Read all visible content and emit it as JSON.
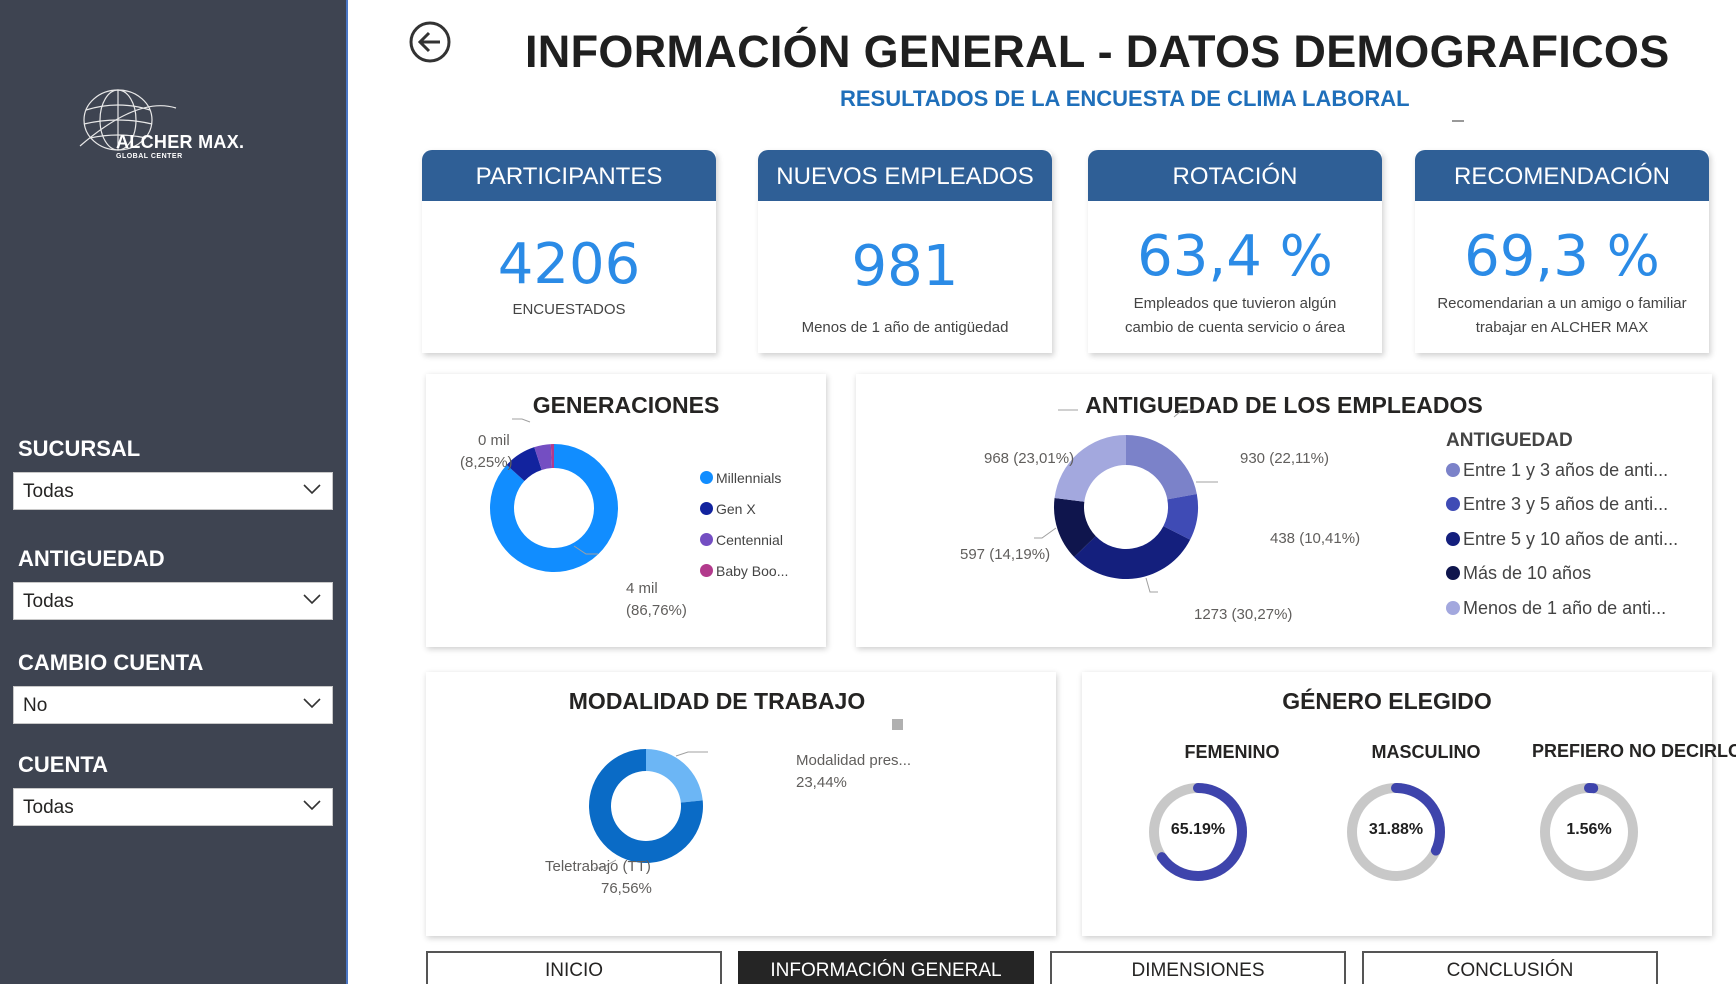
{
  "header": {
    "title": "INFORMACIÓN GENERAL - DATOS DEMOGRAFICOS",
    "subtitle": "RESULTADOS DE LA ENCUESTA DE CLIMA LABORAL"
  },
  "brand": {
    "name": "ALCHER MAX.",
    "tagline": "GLOBAL CENTER"
  },
  "filters": [
    {
      "label": "SUCURSAL",
      "value": "Todas"
    },
    {
      "label": "ANTIGUEDAD",
      "value": "Todas"
    },
    {
      "label": "CAMBIO CUENTA",
      "value": "No"
    },
    {
      "label": "CUENTA",
      "value": "Todas"
    }
  ],
  "kpis": [
    {
      "title": "PARTICIPANTES",
      "value": "4206",
      "caption1": "ENCUESTADOS",
      "caption2": ""
    },
    {
      "title": "NUEVOS EMPLEADOS",
      "value": "981",
      "caption1": "Menos de 1 año de antigüedad",
      "caption2": ""
    },
    {
      "title": "ROTACIÓN",
      "value": "63,4 %",
      "caption1": "Empleados que tuvieron algún",
      "caption2": "cambio de cuenta servicio o área"
    },
    {
      "title": "RECOMENDACIÓN",
      "value": "69,3 %",
      "caption1": "Recomendarian a un amigo o familiar",
      "caption2": "trabajar en ALCHER MAX"
    }
  ],
  "generaciones": {
    "title": "GENERACIONES",
    "label_small_1": "0 mil",
    "label_small_2": "(8,25%)",
    "label_big_1": "4 mil",
    "label_big_2": "(86,76%)",
    "legend": [
      "Millennials",
      "Gen X",
      "Centennial",
      "Baby Boo..."
    ]
  },
  "antiguedad": {
    "title": "ANTIGUEDAD DE LOS EMPLEADOS",
    "legend_title": "ANTIGUEDAD",
    "legend": [
      "Entre 1 y 3 años de anti...",
      "Entre 3 y 5 años de anti...",
      "Entre 5 y 10 años de anti...",
      "Más de 10 años",
      "Menos de 1 año de anti..."
    ],
    "labels": [
      "930 (22,11%)",
      "438 (10,41%)",
      "1273 (30,27%)",
      "597 (14,19%)",
      "968 (23,01%)"
    ]
  },
  "modalidad": {
    "title": "MODALIDAD DE TRABAJO",
    "label_pres_1": "Modalidad pres...",
    "label_pres_2": "23,44%",
    "label_tt_1": "Teletrabajo (TT)",
    "label_tt_2": "76,56%"
  },
  "genero": {
    "title": "GÉNERO ELEGIDO",
    "items": [
      {
        "label": "FEMENINO",
        "value": "65.19%"
      },
      {
        "label": "MASCULINO",
        "value": "31.88%"
      },
      {
        "label": "PREFIERO NO DECIRLO",
        "value": "1.56%"
      }
    ]
  },
  "nav": [
    "INICIO",
    "INFORMACIÓN GENERAL",
    "DIMENSIONES",
    "CONCLUSIÓN"
  ],
  "chart_data": [
    {
      "type": "pie",
      "title": "GENERACIONES",
      "categories": [
        "Millennials",
        "Gen X",
        "Centennial",
        "Baby Boo..."
      ],
      "values": [
        86.76,
        8.25,
        4.2,
        0.79
      ],
      "colors": [
        "#118dff",
        "#12239e",
        "#744ec2",
        "#b23a8c"
      ]
    },
    {
      "type": "pie",
      "title": "ANTIGUEDAD DE LOS EMPLEADOS",
      "categories": [
        "Entre 1 y 3 años de anti...",
        "Entre 3 y 5 años de anti...",
        "Entre 5 y 10 años de anti...",
        "Más de 10 años",
        "Menos de 1 año de anti..."
      ],
      "values": [
        930,
        438,
        1273,
        597,
        968
      ],
      "colors": [
        "#7b82c9",
        "#3f4bb5",
        "#141f7d",
        "#0f154d",
        "#a3a8de"
      ]
    },
    {
      "type": "pie",
      "title": "MODALIDAD DE TRABAJO",
      "categories": [
        "Modalidad pres...",
        "Teletrabajo (TT)"
      ],
      "values": [
        23.44,
        76.56
      ],
      "colors": [
        "#6cb6f5",
        "#0a6bc6"
      ]
    }
  ]
}
